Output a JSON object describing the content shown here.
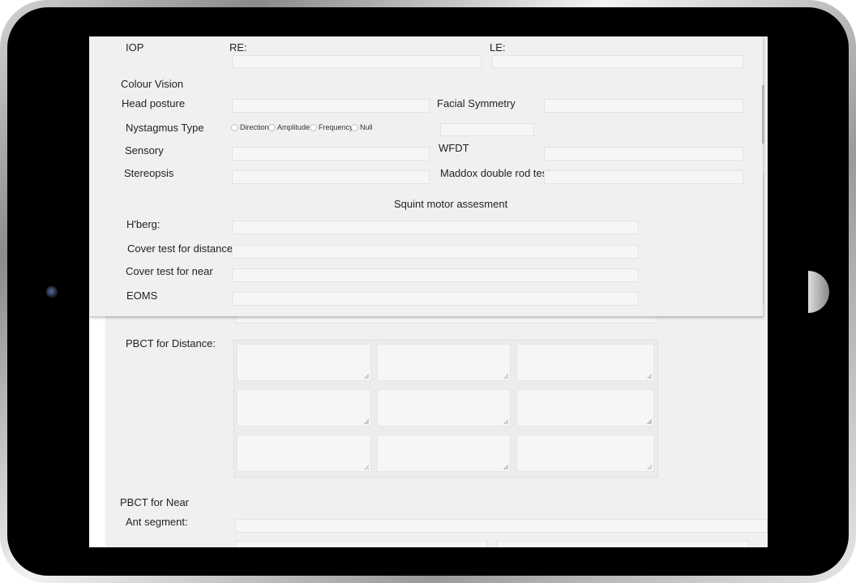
{
  "form": {
    "iop_label": "IOP",
    "re_label": "RE:",
    "le_label": "LE:",
    "colour_vision_label": "Colour Vision",
    "head_posture_label": "Head posture",
    "facial_symmetry_label": "Facial Symmetry",
    "nystagmus_type_label": "Nystagmus Type",
    "nystagmus_options": [
      "Direction",
      "Amplitude",
      "Frequency",
      "Null"
    ],
    "sensory_label": "Sensory",
    "wfdt_label": "WFDT",
    "stereopsis_label": "Stereopsis",
    "maddox_label": "Maddox double rod test",
    "squint_heading": "Squint motor assesment",
    "hberg_label": "H'berg:",
    "cover_distance_label": "Cover test for distance",
    "cover_near_label": "Cover test for near",
    "eoms_label": "EOMS"
  },
  "background_form": {
    "pbct_distance_label": "PBCT for Distance:",
    "pbct_near_label": "PBCT for Near",
    "ant_segment_label": "Ant segment:"
  }
}
